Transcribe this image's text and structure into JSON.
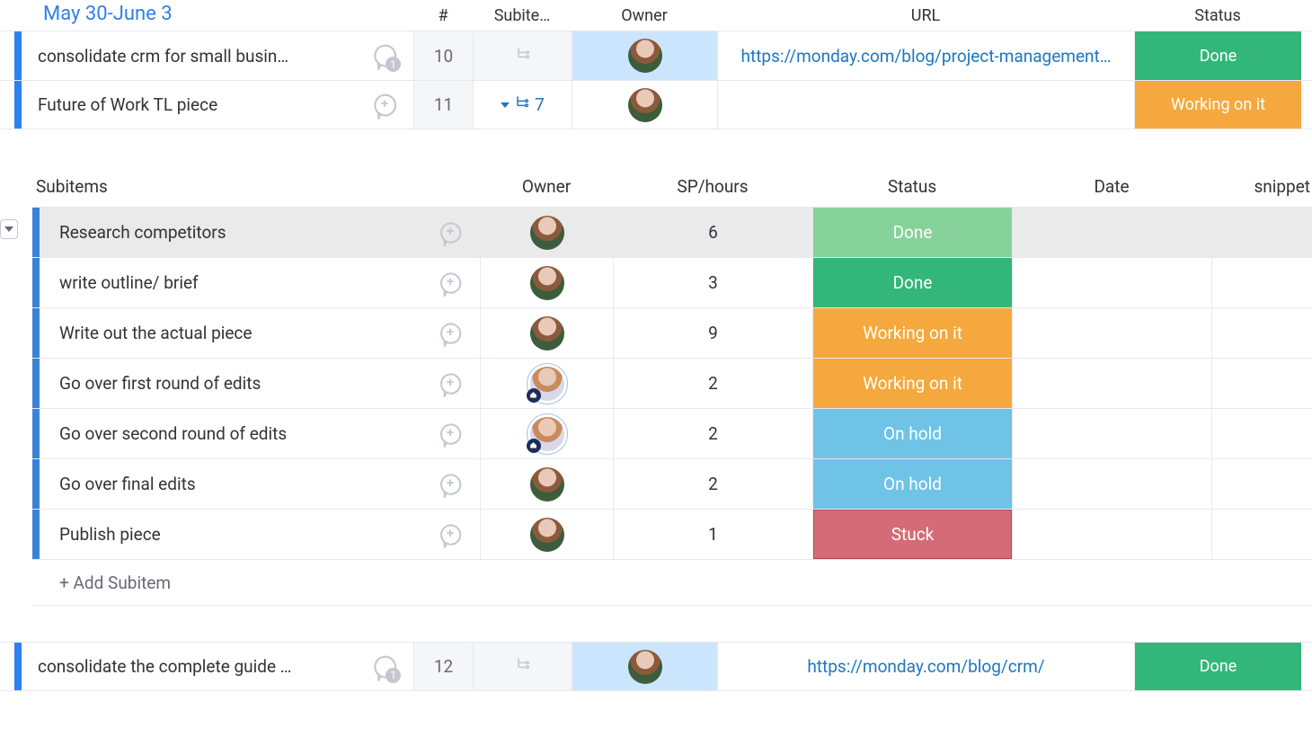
{
  "group": {
    "title": "May 30-June 3"
  },
  "mainColumns": {
    "num": "#",
    "subitems": "Subite…",
    "owner": "Owner",
    "url": "URL",
    "status": "Status"
  },
  "rows": [
    {
      "name": "consolidate crm for small busin…",
      "chatCount": "1",
      "num": "10",
      "subExpanded": false,
      "url": "https://monday.com/blog/project-management…",
      "status": {
        "label": "Done",
        "class": "st-done"
      },
      "ownerHighlight": true
    },
    {
      "name": "Future of Work TL piece",
      "chatPlus": true,
      "num": "11",
      "subExpanded": true,
      "subCount": "7",
      "url": "",
      "status": {
        "label": "Working on it",
        "class": "st-working"
      },
      "ownerHighlight": false
    }
  ],
  "subColumns": {
    "name": "Subitems",
    "owner": "Owner",
    "sp": "SP/hours",
    "status": "Status",
    "date": "Date",
    "snippet": "snippet"
  },
  "subitems": [
    {
      "name": "Research competitors",
      "sp": "6",
      "status": {
        "label": "Done",
        "class": "sst-done-lt"
      },
      "selected": true,
      "ownerBadge": false
    },
    {
      "name": "write outline/ brief",
      "sp": "3",
      "status": {
        "label": "Done",
        "class": "sst-done"
      },
      "selected": false,
      "ownerBadge": false
    },
    {
      "name": "Write out the actual piece",
      "sp": "9",
      "status": {
        "label": "Working on it",
        "class": "sst-working"
      },
      "selected": false,
      "ownerBadge": false
    },
    {
      "name": "Go over first round of edits",
      "sp": "2",
      "status": {
        "label": "Working on it",
        "class": "sst-working"
      },
      "selected": false,
      "ownerBadge": true
    },
    {
      "name": "Go over second round of edits",
      "sp": "2",
      "status": {
        "label": "On hold",
        "class": "sst-hold"
      },
      "selected": false,
      "ownerBadge": true
    },
    {
      "name": "Go over final edits",
      "sp": "2",
      "status": {
        "label": "On hold",
        "class": "sst-hold"
      },
      "selected": false,
      "ownerBadge": false
    },
    {
      "name": "Publish piece",
      "sp": "1",
      "status": {
        "label": "Stuck",
        "class": "sst-stuck"
      },
      "selected": false,
      "ownerBadge": false
    }
  ],
  "addSubitem": "+ Add Subitem",
  "tailRow": {
    "name": "consolidate the complete guide …",
    "chatCount": "1",
    "num": "12",
    "url": "https://monday.com/blog/crm/",
    "status": {
      "label": "Done",
      "class": "st-done"
    },
    "ownerHighlight": true
  }
}
